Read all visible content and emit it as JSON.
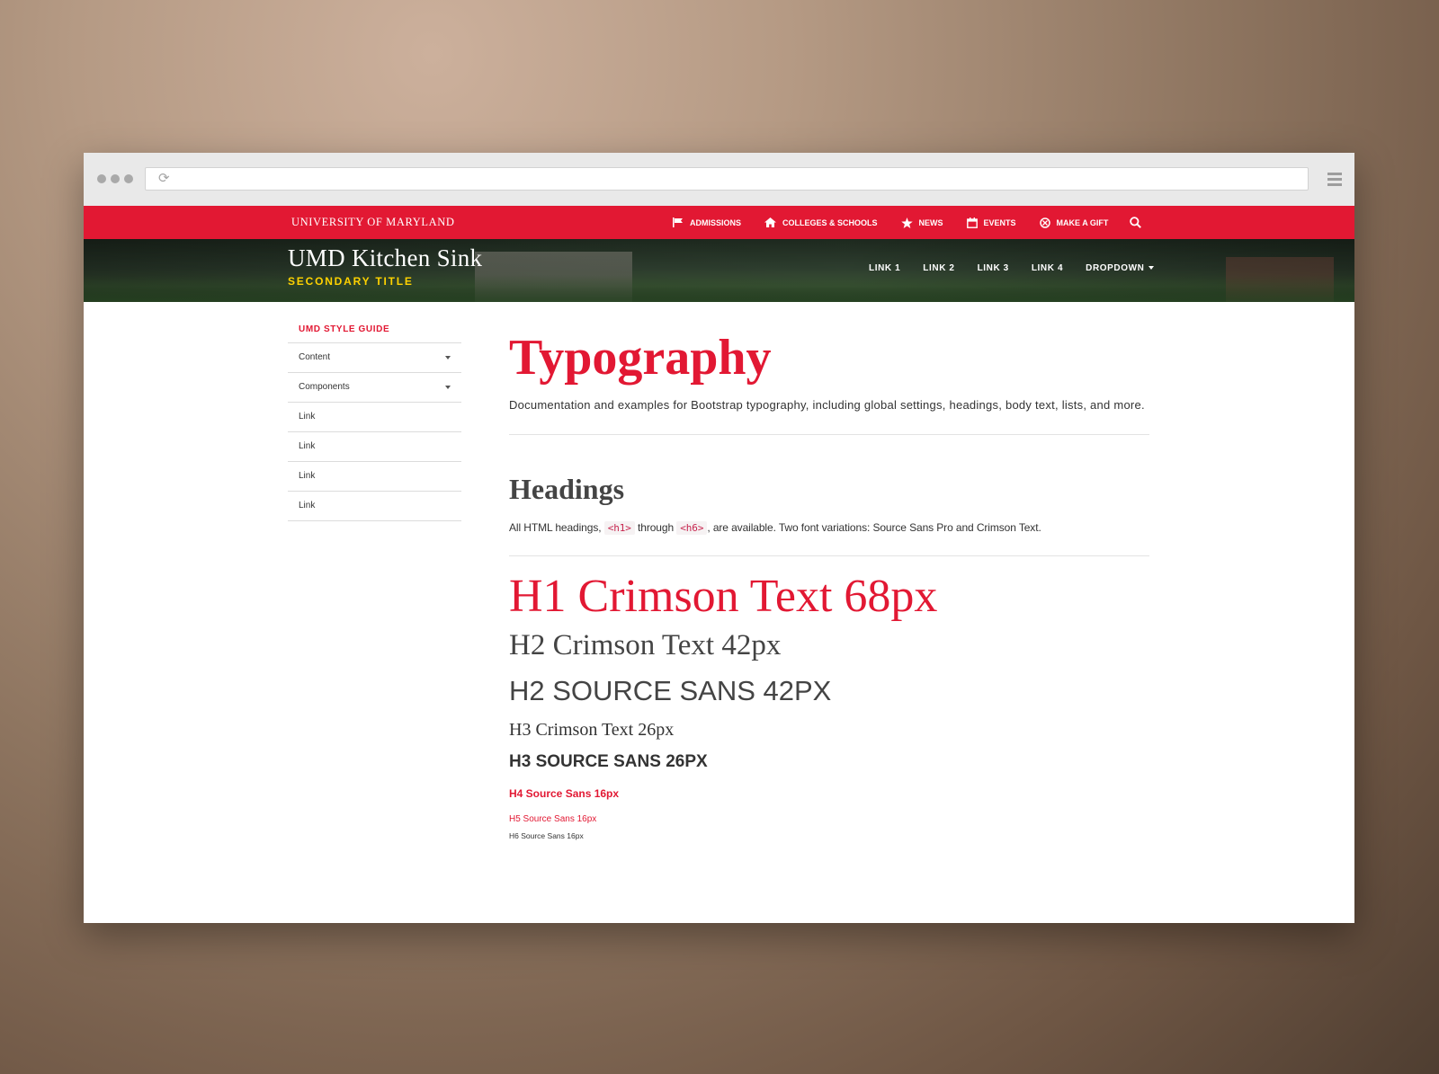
{
  "browser": {
    "url": ""
  },
  "utility_bar": {
    "wordmark": "UNIVERSITY OF MARYLAND",
    "links": [
      {
        "label": "ADMISSIONS",
        "icon": "flag-icon"
      },
      {
        "label": "COLLEGES & SCHOOLS",
        "icon": "home-icon"
      },
      {
        "label": "NEWS",
        "icon": "star-icon"
      },
      {
        "label": "EVENTS",
        "icon": "calendar-icon"
      },
      {
        "label": "MAKE A GIFT",
        "icon": "gift-icon"
      }
    ],
    "search_icon": "search-icon",
    "color": "#e21833"
  },
  "header": {
    "title": "UMD Kitchen Sink",
    "subtitle": "SECONDARY TITLE",
    "subtitle_color": "#ffd200",
    "nav": [
      "LINK 1",
      "LINK 2",
      "LINK 3",
      "LINK 4"
    ],
    "dropdown_label": "DROPDOWN"
  },
  "sidebar": {
    "heading": "UMD STYLE GUIDE",
    "items": [
      {
        "label": "Content",
        "has_caret": true
      },
      {
        "label": "Components",
        "has_caret": true
      },
      {
        "label": "Link",
        "has_caret": false
      },
      {
        "label": "Link",
        "has_caret": false
      },
      {
        "label": "Link",
        "has_caret": false
      },
      {
        "label": "Link",
        "has_caret": false
      }
    ]
  },
  "main": {
    "title": "Typography",
    "lead": "Documentation and examples for Bootstrap typography, including global settings, headings, body text, lists, and more.",
    "headings_section": {
      "title": "Headings",
      "intro_prefix": "All HTML headings,",
      "code_open": "<h1>",
      "through": "through",
      "code_close": "<h6>",
      "intro_suffix": ", are available. Two font variations: Source Sans Pro and Crimson Text."
    },
    "samples": {
      "h1": "H1 Crimson Text 68px",
      "h2_crimson": "H2 Crimson Text 42px",
      "h2_sans": "H2 SOURCE SANS 42PX",
      "h3_crimson": "H3 Crimson Text 26px",
      "h3_sans": "H3 SOURCE SANS 26PX",
      "h4": "H4 Source Sans 16px",
      "h5": "H5 Source Sans 16px",
      "h6": "H6 Source Sans 16px"
    }
  }
}
